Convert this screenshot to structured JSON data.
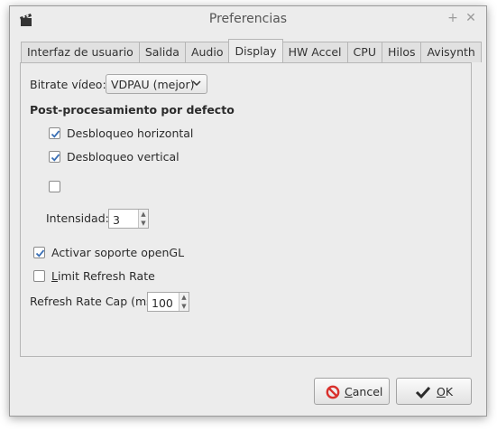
{
  "window": {
    "title": "Preferencias"
  },
  "tabs": [
    {
      "label": "Interfaz de usuario"
    },
    {
      "label": "Salida"
    },
    {
      "label": "Audio"
    },
    {
      "label": "Display",
      "active": true
    },
    {
      "label": "HW Accel"
    },
    {
      "label": "CPU"
    },
    {
      "label": "Hilos"
    },
    {
      "label": "Avisynth"
    }
  ],
  "display": {
    "bitrate_label": "Bitrate vídeo:",
    "bitrate_value": "VDPAU (mejor)",
    "postproc_heading": "Post-procesamiento por defecto",
    "deblock_h": {
      "label": "Desbloqueo horizontal",
      "checked": true
    },
    "deblock_v": {
      "label": "Desbloqueo vertical",
      "checked": true
    },
    "extra": {
      "label": "",
      "checked": false
    },
    "intensity_label": "Intensidad:",
    "intensity_value": "3",
    "opengl": {
      "label": "Activar soporte openGL",
      "checked": true
    },
    "limit_refresh": {
      "label_first": "L",
      "label_rest": "imit Refresh Rate",
      "checked": false
    },
    "refresh_cap_label": "Refresh Rate Cap (ms)",
    "refresh_cap_value": "100"
  },
  "buttons": {
    "cancel_first": "C",
    "cancel_rest": "ancel",
    "ok_first": "O",
    "ok_rest": "K"
  },
  "colors": {
    "check": "#3a6fb5",
    "cancel_icon": "#d9302c"
  }
}
